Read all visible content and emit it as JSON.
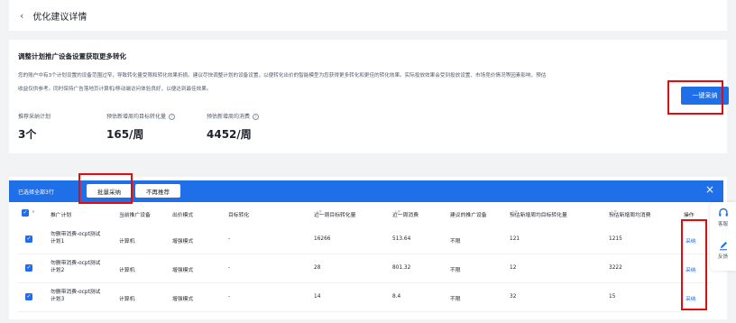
{
  "header": {
    "back_icon": "chevron-left-icon",
    "title": "优化建议详情"
  },
  "suggestion": {
    "title": "调整计划推广设备设置获取更多转化",
    "description_line1": "您的账户中有3个计划设置的设备范围过窄，导致转化量受限和转化效果折损。建议尽快调整计划的设备设置，以便转化出价的智能模型为您获得更多转化和更佳的转化效果。实际投放效果会受到投放设置、市场竞价情况等因素影响，预估",
    "description_line2": "收益仅供参考。同时保持广告落地页计算机/移动端访问体验良好，以便达到最佳效果。",
    "adopt_all_label": "一键采纳",
    "stats": [
      {
        "label": "推荐采纳计划",
        "value": "3个"
      },
      {
        "label": "预估新增周均目标转化量",
        "value": "165/周"
      },
      {
        "label": "预估新增周均消费",
        "value": "4452/周"
      }
    ]
  },
  "bulk_bar": {
    "selected_text": "已选择全部3行",
    "batch_adopt_label": "批量采纳",
    "not_recommend_label": "不再推荐",
    "close_icon": "close-icon"
  },
  "table": {
    "columns": [
      "推广计划",
      "当前推广设备",
      "出价模式",
      "目标转化",
      "近一周目标转化量",
      "近一周消费",
      "建议的推广设备",
      "预估新增周均目标转化量",
      "预估新增周均消费",
      "操作"
    ],
    "rows": [
      {
        "plan_line1": "勿删带消费-ocpt测试",
        "plan_line2": "计划1",
        "device": "计算机",
        "bid_mode": "增强模式",
        "target": "-",
        "conv": "16266",
        "cost": "513.64",
        "suggest": "不限",
        "est_conv": "121",
        "est_cost": "1215",
        "action": "采纳"
      },
      {
        "plan_line1": "勿删带消费-ocpt测试",
        "plan_line2": "计划2",
        "device": "计算机",
        "bid_mode": "增强模式",
        "target": "-",
        "conv": "28",
        "cost": "801.32",
        "suggest": "不限",
        "est_conv": "12",
        "est_cost": "3222",
        "action": "采纳"
      },
      {
        "plan_line1": "勿删带消费-ocpt测试",
        "plan_line2": "计划3",
        "device": "计算机",
        "bid_mode": "增强模式",
        "target": "-",
        "conv": "14",
        "cost": "8.4",
        "suggest": "不限",
        "est_conv": "32",
        "est_cost": "15",
        "action": "采纳"
      }
    ]
  },
  "float_panel": {
    "service_label": "客服",
    "service_icon": "headset-icon",
    "feedback_label": "反馈",
    "feedback_icon": "edit-icon"
  },
  "colors": {
    "accent": "#1f6fe8",
    "highlight_box": "#e30b0b"
  }
}
